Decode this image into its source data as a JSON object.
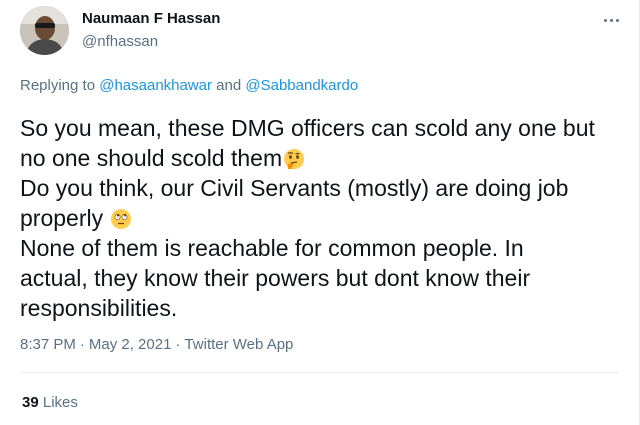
{
  "author": {
    "name": "Naumaan F Hassan",
    "handle": "@nfhassan"
  },
  "replying": {
    "prefix": "Replying to ",
    "user1": "@hasaankhawar",
    "conjunction": " and ",
    "user2": "@Sabbandkardo"
  },
  "tweet": {
    "lines": [
      "So you mean, these DMG officers can scold any one but",
      "no one should scold them",
      "Do you think, our Civil Servants (mostly) are doing job",
      "properly ",
      "None of them is reachable for common people. In",
      "actual, they know their powers but dont know their",
      "responsibilities."
    ],
    "emojis": [
      "thinking-face-emoji",
      "face-with-rolling-eyes-emoji"
    ]
  },
  "meta": {
    "time": "8:37 PM",
    "separator": "·",
    "date": "May 2, 2021",
    "source": "Twitter Web App"
  },
  "stats": {
    "likes_count": "39",
    "likes_label": "Likes"
  },
  "colors": {
    "link": "#1b95e0",
    "secondary_text": "#5b7083",
    "primary_text": "#0f1419",
    "divider": "#e6ecf0"
  }
}
